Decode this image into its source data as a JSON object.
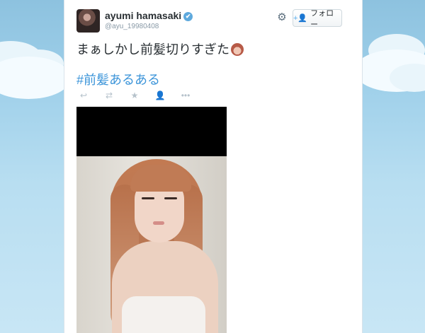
{
  "tweet": {
    "author": {
      "display_name": "ayumi hamasaki",
      "handle": "@ayu_19980408",
      "verified_icon": "✔"
    },
    "follow_button": {
      "label": "フォロー",
      "icon": "+👤"
    },
    "text": "まぁしかし前髪切りすぎた",
    "hashtag": "#前髪あるある",
    "actions": [
      "reply-icon",
      "retweet-icon",
      "favorite-icon",
      "add-user-icon",
      "more-icon"
    ],
    "action_glyphs": {
      "reply": "↩",
      "retweet": "⇄",
      "favorite": "★",
      "add_user": "👤",
      "more": "•••"
    }
  },
  "colors": {
    "hashtag": "#3b94d9",
    "text": "#292f33",
    "muted": "#8899a6",
    "sky": "#a9cfe6"
  }
}
